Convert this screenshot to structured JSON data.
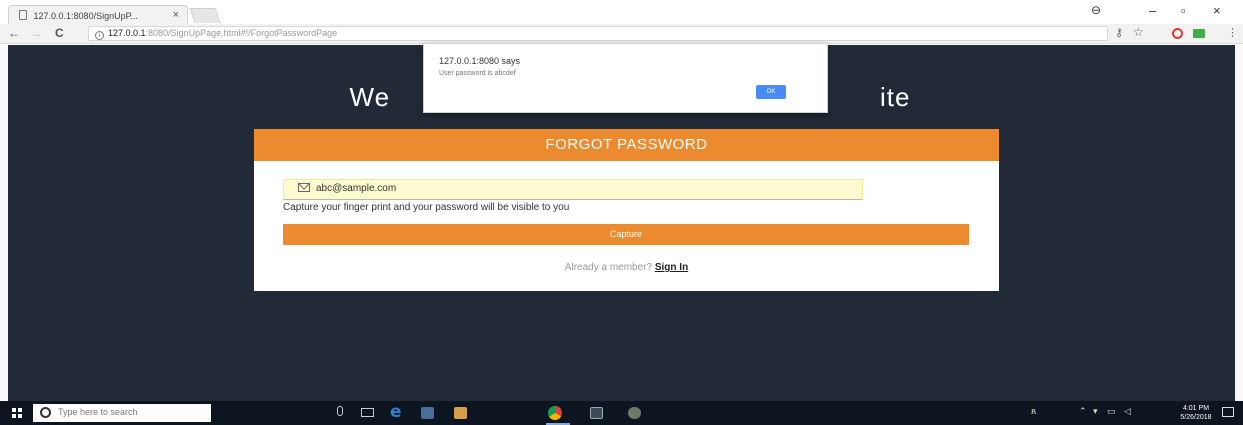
{
  "browser": {
    "tab_title": "127.0.0.1:8080/SignUpP...",
    "tab_close": "×",
    "window_controls": {
      "minimize": "–",
      "maximize": "▫",
      "close": "×"
    },
    "nav": {
      "back": "←",
      "forward": "→",
      "reload": "C"
    },
    "url": {
      "host": "127.0.0.1",
      "rest": ":8080/SignUpPage.html#!/ForgotPasswordPage"
    },
    "toolbar_icons": [
      "key-icon",
      "star-icon",
      "opera-icon",
      "extension-icon",
      "menu-icon"
    ]
  },
  "page": {
    "heading_visible_left": "We",
    "heading_visible_right": "ite",
    "card": {
      "header": "FORGOT PASSWORD",
      "email_value": "abc@sample.com",
      "hint": "Capture your finger print and your password will be visible to you",
      "capture_button": "Capture",
      "member_text": "Already a member?",
      "signin_link": "Sign In"
    }
  },
  "dialog": {
    "title": "127.0.0.1:8080 says",
    "message": "User password is abcdef",
    "ok_label": "OK"
  },
  "taskbar": {
    "search_placeholder": "Type here to search",
    "clock_time": "4:01 PM",
    "clock_date": "5/26/2018"
  },
  "colors": {
    "page_background": "#212a36",
    "accent_orange": "#ec8a2f",
    "autofill_yellow": "#fbfbcf",
    "dialog_ok_blue": "#4a8af4"
  }
}
